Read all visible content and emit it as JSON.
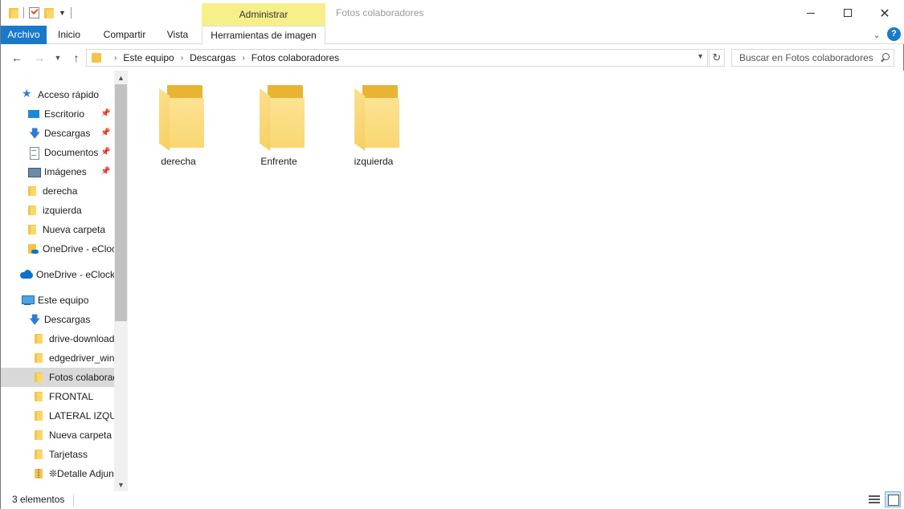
{
  "window": {
    "title": "Fotos colaboradores",
    "contextual_tab_group": "Administrar"
  },
  "ribbon": {
    "tabs": [
      {
        "label": "Archivo"
      },
      {
        "label": "Inicio"
      },
      {
        "label": "Compartir"
      },
      {
        "label": "Vista"
      },
      {
        "label": "Herramientas de imagen"
      }
    ],
    "help_label": "?"
  },
  "address_bar": {
    "breadcrumbs": [
      "Este equipo",
      "Descargas",
      "Fotos colaboradores"
    ]
  },
  "search": {
    "placeholder": "Buscar en Fotos colaboradores",
    "value": ""
  },
  "nav_pane": {
    "items": [
      {
        "label": "Acceso rápido",
        "icon": "star-icon",
        "pinned": false
      },
      {
        "label": "Escritorio",
        "icon": "desktop-icon",
        "pinned": true
      },
      {
        "label": "Descargas",
        "icon": "download-icon",
        "pinned": true
      },
      {
        "label": "Documentos",
        "icon": "document-icon",
        "pinned": true
      },
      {
        "label": "Imágenes",
        "icon": "images-icon",
        "pinned": true
      },
      {
        "label": "derecha",
        "icon": "folder-icon",
        "pinned": false
      },
      {
        "label": "izquierda",
        "icon": "folder-icon",
        "pinned": false
      },
      {
        "label": "Nueva carpeta",
        "icon": "folder-icon",
        "pinned": false
      },
      {
        "label": "OneDrive - eClock",
        "icon": "onedrive-folder-icon",
        "pinned": false
      },
      {
        "label": "OneDrive - eClock",
        "icon": "onedrive-cloud-icon",
        "pinned": false
      },
      {
        "label": "Este equipo",
        "icon": "computer-icon",
        "pinned": false
      },
      {
        "label": "Descargas",
        "icon": "download-icon",
        "pinned": false
      },
      {
        "label": "drive-download",
        "icon": "folder-icon",
        "pinned": false
      },
      {
        "label": "edgedriver_win",
        "icon": "folder-icon",
        "pinned": false
      },
      {
        "label": "Fotos colaboradores",
        "icon": "folder-icon",
        "pinned": false,
        "selected": true
      },
      {
        "label": "FRONTAL",
        "icon": "folder-icon",
        "pinned": false
      },
      {
        "label": "LATERAL IZQUIERDO",
        "icon": "folder-icon",
        "pinned": false
      },
      {
        "label": "Nueva carpeta",
        "icon": "folder-icon",
        "pinned": false
      },
      {
        "label": "Tarjetass",
        "icon": "folder-icon",
        "pinned": false
      },
      {
        "label": "❊Detalle Adjuntos",
        "icon": "zip-folder-icon",
        "pinned": false
      }
    ]
  },
  "content": {
    "items": [
      {
        "name": "derecha",
        "icon": "folder-icon"
      },
      {
        "name": "Enfrente",
        "icon": "folder-icon"
      },
      {
        "name": "izquierda",
        "icon": "folder-icon"
      }
    ]
  },
  "status_bar": {
    "item_count": "3 elementos",
    "active_view": "large-icons"
  },
  "colors": {
    "accent": "#1979ca",
    "contextual_tab": "#f7f08a",
    "folder": "#f8d26b",
    "selected_row": "#d9d9d9"
  }
}
